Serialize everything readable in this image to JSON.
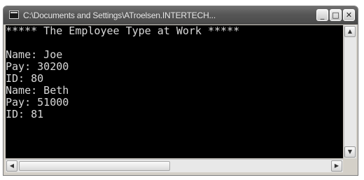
{
  "window": {
    "title": "C:\\Documents and Settings\\ATroelsen.INTERTECH..."
  },
  "title_buttons": {
    "minimize": "_",
    "maximize": "□",
    "close": "✕"
  },
  "console": {
    "header": "***** The Employee Type at Work *****",
    "lines": [
      "Name: Joe",
      "Pay: 30200",
      "ID: 80",
      "Name: Beth",
      "Pay: 51000",
      "ID: 81"
    ]
  },
  "scroll_glyphs": {
    "up": "▲",
    "down": "▼",
    "left": "◀",
    "right": "▶"
  },
  "icons": {
    "window": "console-window-icon",
    "scroll_up": "arrow-up-icon",
    "scroll_down": "arrow-down-icon",
    "scroll_left": "arrow-left-icon",
    "scroll_right": "arrow-right-icon"
  },
  "colors": {
    "console_bg": "#000000",
    "console_text": "#d8d8d8",
    "titlebar": "#565656"
  }
}
